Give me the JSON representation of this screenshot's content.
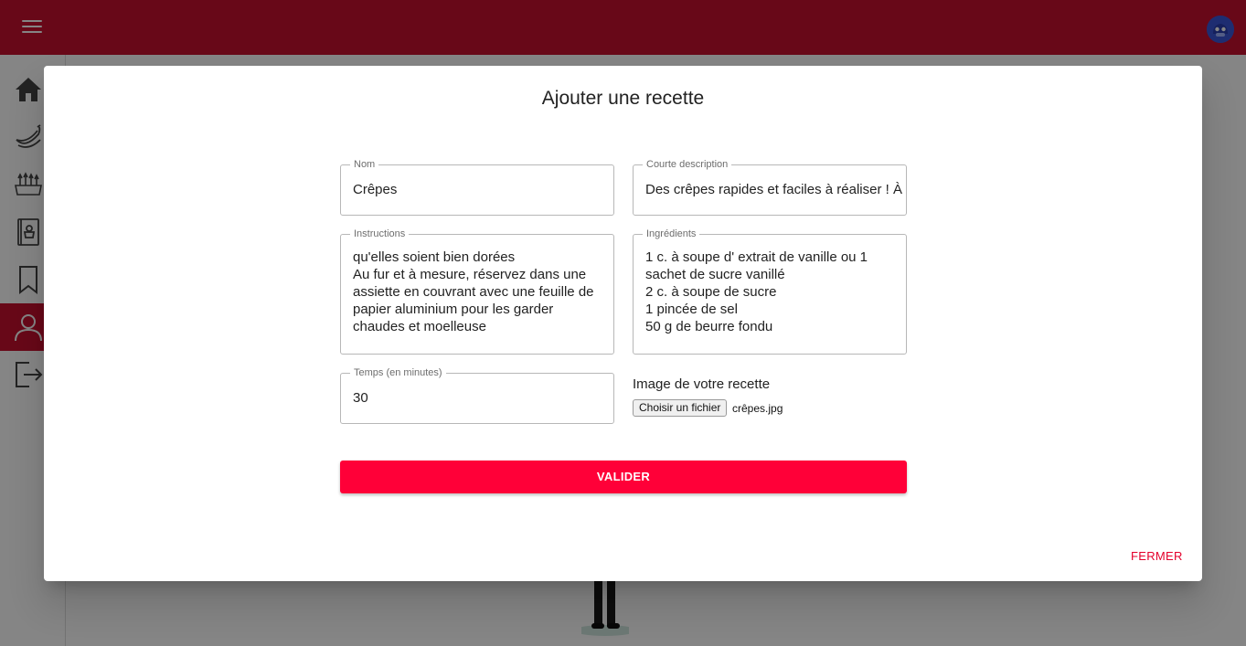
{
  "icons": {
    "menu": "menu-icon",
    "avatar": "user-avatar-icon",
    "home": "home-icon",
    "fruit": "banana-icon",
    "vegetables": "vegetables-icon",
    "recipes": "recipe-book-icon",
    "bookmarks": "bookmark-icon",
    "profile": "user-icon",
    "logout": "logout-icon"
  },
  "colors": {
    "topbar": "#c8102e",
    "active_sidebar": "#c8102e",
    "primary_button": "#ff0038",
    "close_link": "#e4002b"
  },
  "modal": {
    "title": "Ajouter une recette",
    "fields": {
      "name": {
        "label": "Nom",
        "value": "Crêpes"
      },
      "short_description": {
        "label": "Courte description",
        "value": "Des crêpes rapides et faciles à réaliser ! À"
      },
      "instructions": {
        "label": "Instructions",
        "lines": [
          "qu'elles soient bien dorées",
          "Au fur et à mesure, réservez dans une",
          "assiette en couvrant avec une feuille de",
          "papier aluminium pour les garder",
          "chaudes et moelleuse"
        ]
      },
      "ingredients": {
        "label": "Ingrédients",
        "lines": [
          "1 c. à soupe d' extrait de vanille ou 1",
          "sachet de sucre vanillé",
          "2 c. à soupe de sucre",
          "1 pincée de sel",
          "50 g de beurre fondu"
        ]
      },
      "time": {
        "label": "Temps (en minutes)",
        "value": "30"
      }
    },
    "image": {
      "label": "Image de votre recette",
      "button": "Choisir un fichier",
      "file_name": "crêpes.jpg"
    },
    "submit": "VALIDER",
    "close": "FERMER"
  }
}
